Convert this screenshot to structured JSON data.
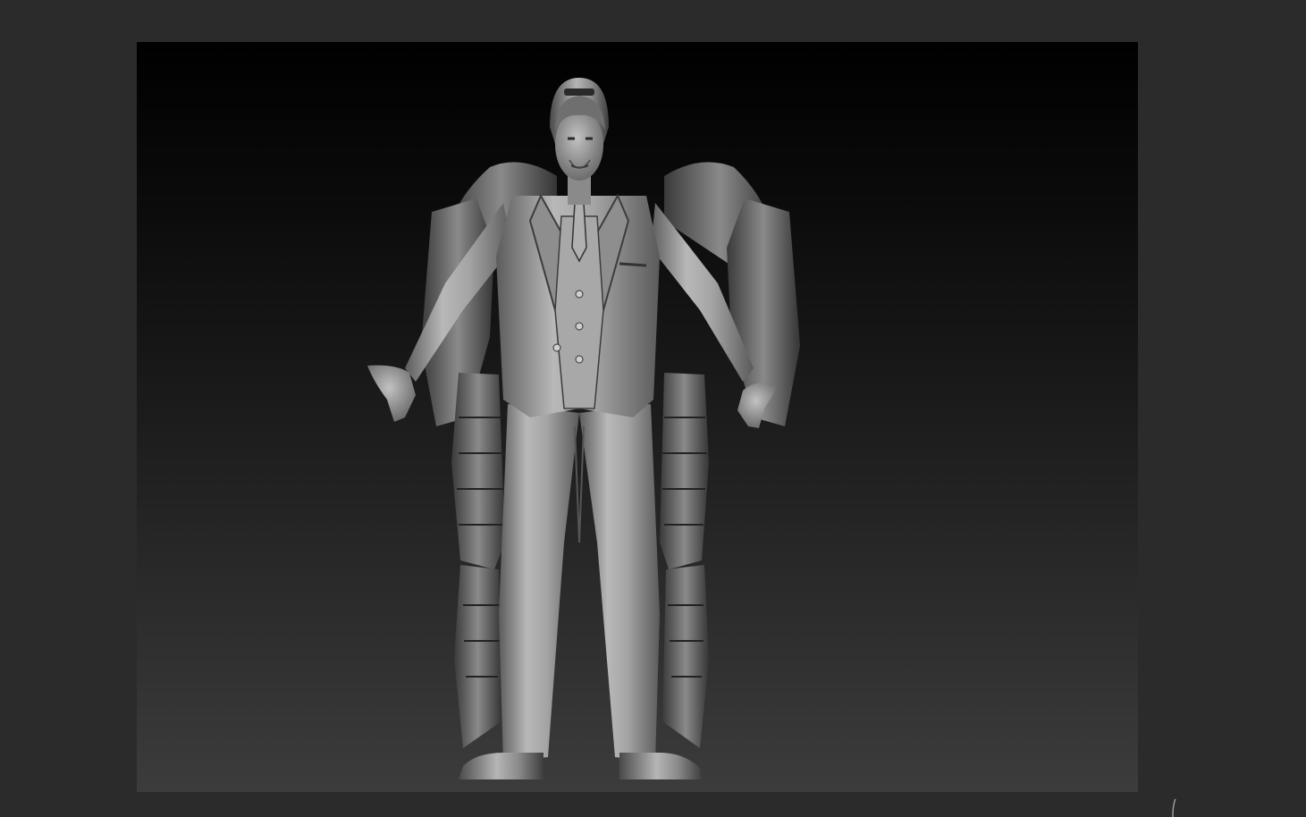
{
  "app": {
    "background_color": "#2b2b2b"
  },
  "viewport": {
    "gradient_top": "#000000",
    "gradient_bottom": "#3c3c3c",
    "model_material_color": "#9a9a9a"
  },
  "icons": {
    "corner": "resize-corner-icon"
  }
}
